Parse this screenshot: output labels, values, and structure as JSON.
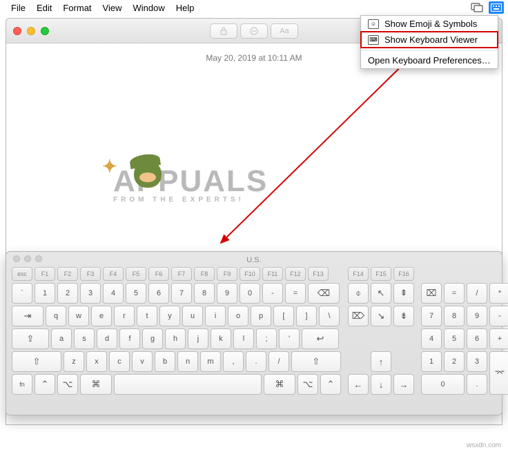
{
  "menubar": {
    "items": [
      "File",
      "Edit",
      "Format",
      "View",
      "Window",
      "Help"
    ]
  },
  "dropdown": {
    "emoji": "Show Emoji & Symbols",
    "keyboard_viewer": "Show Keyboard Viewer",
    "prefs": "Open Keyboard Preferences…"
  },
  "window": {
    "timestamp": "May 20, 2019 at 10:11 AM"
  },
  "watermark": {
    "title": "APPUALS",
    "subtitle": "FROM THE EXPERTS!"
  },
  "keyboard": {
    "title": "U.S.",
    "fn_row": [
      "esc",
      "F1",
      "F2",
      "F3",
      "F4",
      "F5",
      "F6",
      "F7",
      "F8",
      "F9",
      "F10",
      "F11",
      "F12",
      "F13"
    ],
    "fn_mid": [
      "F14",
      "F15",
      "F16"
    ],
    "row1": [
      "`",
      "1",
      "2",
      "3",
      "4",
      "5",
      "6",
      "7",
      "8",
      "9",
      "0",
      "-",
      "="
    ],
    "backspace": "⌫",
    "tab": "⇥",
    "row2": [
      "q",
      "w",
      "e",
      "r",
      "t",
      "y",
      "u",
      "i",
      "o",
      "p",
      "[",
      "]",
      "\\"
    ],
    "caps": "⇪",
    "row3": [
      "a",
      "s",
      "d",
      "f",
      "g",
      "h",
      "j",
      "k",
      "l",
      ";",
      "'"
    ],
    "return": "↩",
    "shift": "⇧",
    "row4": [
      "z",
      "x",
      "c",
      "v",
      "b",
      "n",
      "m",
      ",",
      ".",
      "/"
    ],
    "bottom": {
      "fn": "fn",
      "ctrl": "⌃",
      "opt": "⌥",
      "cmd": "⌘"
    },
    "nav_top": [
      "⌽",
      "↖",
      "⇞"
    ],
    "nav_bot": [
      "⌦",
      "↘",
      "⇟"
    ],
    "arrows": {
      "up": "↑",
      "down": "↓",
      "left": "←",
      "right": "→"
    },
    "numpad": {
      "r0": [
        "⌧",
        "=",
        "/",
        "*"
      ],
      "r1": [
        "7",
        "8",
        "9",
        "-"
      ],
      "r2": [
        "4",
        "5",
        "6",
        "+"
      ],
      "r3": [
        "1",
        "2",
        "3"
      ],
      "enter": "⌤",
      "zero": "0",
      "dot": "."
    }
  },
  "footer": "wsxdn.com"
}
